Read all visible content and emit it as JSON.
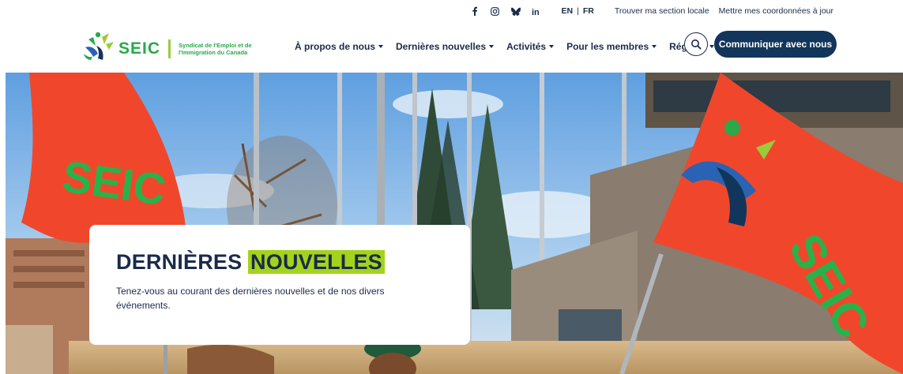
{
  "utility": {
    "social_icons": [
      "facebook-icon",
      "instagram-icon",
      "bluesky-icon",
      "linkedin-icon"
    ],
    "lang_en": "EN",
    "lang_sep": "|",
    "lang_fr": "FR",
    "find_local": "Trouver ma section locale",
    "update_info": "Mettre mes coordonnées à jour"
  },
  "logo": {
    "word": "SEIC",
    "tagline": "Syndicat de l'Emploi et de l'Immigration du Canada"
  },
  "nav": {
    "items": [
      {
        "label": "À propos de nous"
      },
      {
        "label": "Dernières nouvelles"
      },
      {
        "label": "Activités"
      },
      {
        "label": "Pour les membres"
      },
      {
        "label": "Régions"
      }
    ]
  },
  "cta_label": "Communiquer avec nous",
  "hero": {
    "title_part1": "DERNIÈRES",
    "title_part2": "NOUVELLES",
    "description": "Tenez-vous au courant des dernières nouvelles et de nos divers événements.",
    "flag_text": "SEIC"
  },
  "colors": {
    "navy": "#12355b",
    "green": "#2aa84a",
    "highlight": "#a3d31a",
    "flag_red": "#f0472c"
  }
}
